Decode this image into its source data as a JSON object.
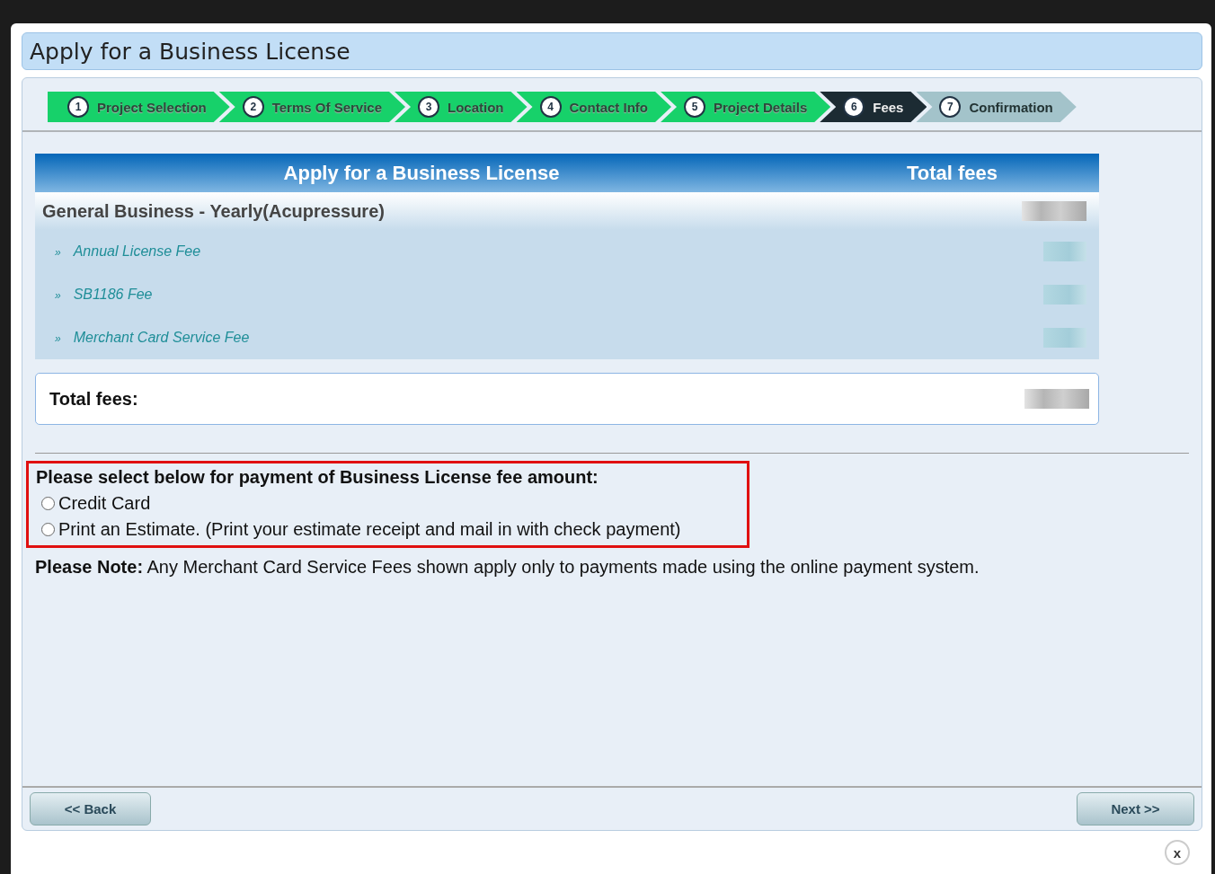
{
  "dialog": {
    "title": "Apply for a Business License"
  },
  "steps": [
    {
      "number": "1",
      "label": "Project Selection",
      "kind": "done"
    },
    {
      "number": "2",
      "label": "Terms Of Service",
      "kind": "done"
    },
    {
      "number": "3",
      "label": "Location",
      "kind": "done"
    },
    {
      "number": "4",
      "label": "Contact Info",
      "kind": "done"
    },
    {
      "number": "5",
      "label": "Project Details",
      "kind": "done"
    },
    {
      "number": "6",
      "label": "Fees",
      "kind": "current"
    },
    {
      "number": "7",
      "label": "Confirmation",
      "kind": "todo"
    }
  ],
  "fee_table": {
    "columns": [
      "Apply for a Business License",
      "Total fees"
    ],
    "group": "General Business - Yearly(Acupressure)",
    "items": [
      {
        "bullet": "»",
        "label": "Annual License Fee"
      },
      {
        "bullet": "»",
        "label": "SB1186 Fee"
      },
      {
        "bullet": "»",
        "label": "Merchant Card Service Fee"
      }
    ],
    "total_label": "Total fees:"
  },
  "payment": {
    "prompt": "Please select below for payment of Business License fee amount:",
    "options": [
      {
        "label": "Credit Card",
        "selected": false
      },
      {
        "label": "Print an Estimate. (Print your estimate receipt and mail in with check payment)",
        "selected": false
      }
    ]
  },
  "note": "**Please Note:** Any Merchant Card Service Fees shown apply only to payments made using the online payment system.",
  "buttons": {
    "back": "<< Back",
    "next": "Next >>"
  },
  "close": "x"
}
